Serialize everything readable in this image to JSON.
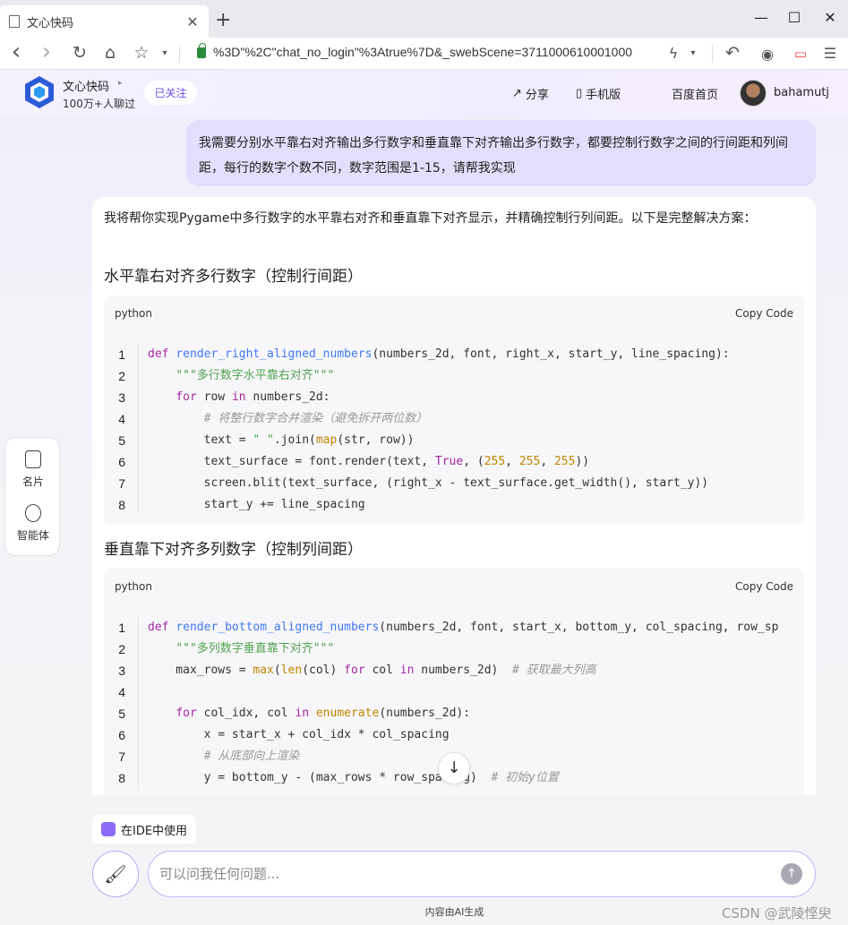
{
  "browser": {
    "tab_title": "文心快码",
    "url": "%3D\"%2C\"chat_no_login\"%3Atrue%7D&_swebScene=3711000610001000",
    "new_tab": "+",
    "minimize": "—",
    "maximize": "☐",
    "close": "✕",
    "back": "‹",
    "forward": "›",
    "reload": "↻",
    "home": "⌂",
    "star": "☆",
    "bolt": "ϟ",
    "undo": "↶",
    "menu": "☰"
  },
  "header": {
    "brand": "文心快码",
    "subtitle": "100万+人聊过",
    "follow": "已关注",
    "share": "分享",
    "mobile": "手机版",
    "home": "百度首页",
    "username": "bahamutj"
  },
  "chat": {
    "user_message": "我需要分别水平靠右对齐输出多行数字和垂直靠下对齐输出多行数字，都要控制行数字之间的行间距和列间距，每行的数字个数不同，数字范围是1-15，请帮我实现",
    "intro": "我将帮你实现Pygame中多行数字的水平靠右对齐和垂直靠下对齐显示，并精确控制行列间距。以下是完整解决方案：",
    "section1_title": "水平靠右对齐多行数字（控制行间距）",
    "section2_title": "垂直靠下对齐多列数字（控制列间距）",
    "code1_lang": "python",
    "code2_lang": "python",
    "copy_label": "Copy Code"
  },
  "code1": [
    {
      "n": "1",
      "t": "def render_right_aligned_numbers(numbers_2d, font, right_x, start_y, line_spacing):"
    },
    {
      "n": "2",
      "t": "    \"\"\"多行数字水平靠右对齐\"\"\""
    },
    {
      "n": "3",
      "t": "    for row in numbers_2d:"
    },
    {
      "n": "4",
      "t": "        # 将整行数字合并渲染（避免拆开两位数）"
    },
    {
      "n": "5",
      "t": "        text = \" \".join(map(str, row))"
    },
    {
      "n": "6",
      "t": "        text_surface = font.render(text, True, (255, 255, 255))"
    },
    {
      "n": "7",
      "t": "        screen.blit(text_surface, (right_x - text_surface.get_width(), start_y))"
    },
    {
      "n": "8",
      "t": "        start_y += line_spacing"
    }
  ],
  "code2": [
    {
      "n": "1",
      "t": "def render_bottom_aligned_numbers(numbers_2d, font, start_x, bottom_y, col_spacing, row_sp"
    },
    {
      "n": "2",
      "t": "    \"\"\"多列数字垂直靠下对齐\"\"\""
    },
    {
      "n": "3",
      "t": "    max_rows = max(len(col) for col in numbers_2d)  # 获取最大列高"
    },
    {
      "n": "4",
      "t": ""
    },
    {
      "n": "5",
      "t": "    for col_idx, col in enumerate(numbers_2d):"
    },
    {
      "n": "6",
      "t": "        x = start_x + col_idx * col_spacing"
    },
    {
      "n": "7",
      "t": "        # 从底部向上渲染"
    },
    {
      "n": "8",
      "t": "        y = bottom_y - (max_rows * row_spacing)  # 初始y位置"
    }
  ],
  "side": {
    "card": "名片",
    "agent": "智能体"
  },
  "scroll_down": "↓",
  "bottom": {
    "ide_label": "在IDE中使用",
    "placeholder": "可以问我任何问题...",
    "ai_notice": "内容由AI生成",
    "watermark": "CSDN @武陵悭臾",
    "send": "↑",
    "brush": "🖌"
  },
  "colors": {
    "accent": "#6c4cf5",
    "user_bubble": "#e4ddfb",
    "keyword": "#a626a4",
    "function": "#4078f2",
    "string": "#50a14f",
    "builtin": "#c18401"
  }
}
